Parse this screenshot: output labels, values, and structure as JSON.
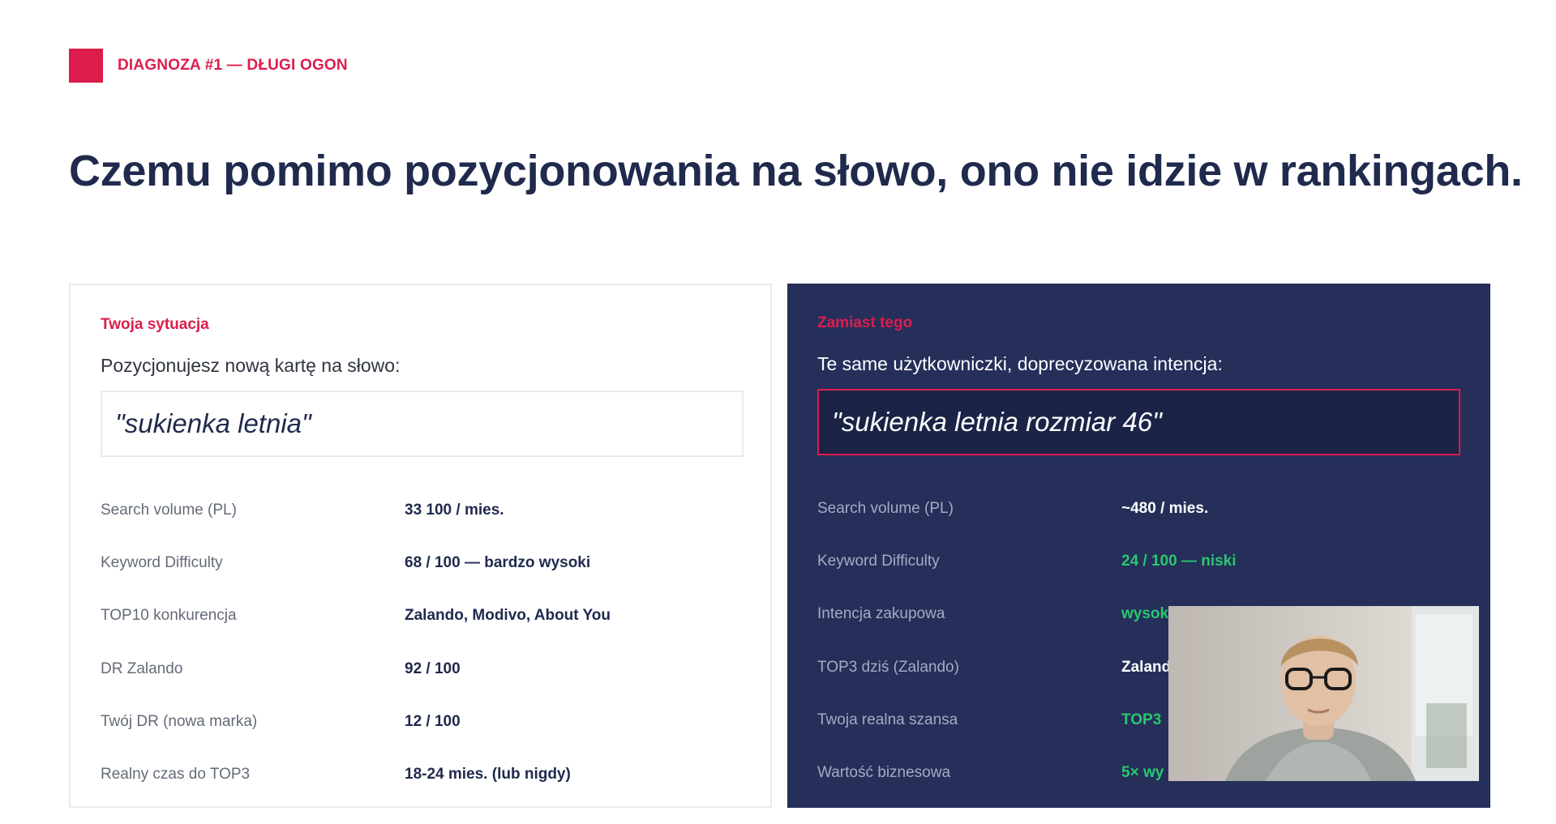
{
  "header": {
    "eyebrow": "DIAGNOZA #1 — DŁUGI OGON",
    "title": "Czemu pomimo pozycjonowania na słowo, ono nie idzie w rankingach."
  },
  "left_panel": {
    "label": "Twoja sytuacja",
    "intro": "Pozycjonujesz nową kartę na słowo:",
    "keyword": "\"sukienka letnia\"",
    "rows": [
      {
        "label": "Search volume (PL)",
        "value": "33 100 / mies."
      },
      {
        "label": "Keyword Difficulty",
        "value": "68 / 100 — bardzo wysoki"
      },
      {
        "label": "TOP10 konkurencja",
        "value": "Zalando, Modivo, About You"
      },
      {
        "label": "DR Zalando",
        "value": "92 / 100"
      },
      {
        "label": "Twój DR (nowa marka)",
        "value": "12 / 100"
      },
      {
        "label": "Realny czas do TOP3",
        "value": "18-24 mies. (lub nigdy)"
      }
    ]
  },
  "right_panel": {
    "label": "Zamiast tego",
    "intro": "Te same użytkowniczki, doprecyzowana intencja:",
    "keyword": "\"sukienka letnia rozmiar 46\"",
    "rows": [
      {
        "label": "Search volume (PL)",
        "value": "~480 / mies.",
        "color": "white"
      },
      {
        "label": "Keyword Difficulty",
        "value": "24 / 100 — niski",
        "color": "green"
      },
      {
        "label": "Intencja zakupowa",
        "value": "wysoka — konkretny rozmiar",
        "color": "green"
      },
      {
        "label": "TOP3 dziś (Zalando)",
        "value": "Zaland",
        "color": "white"
      },
      {
        "label": "Twoja realna szansa",
        "value": "TOP3",
        "color": "green"
      },
      {
        "label": "Wartość biznesowa",
        "value": "5× wy",
        "color": "green"
      }
    ]
  },
  "colors": {
    "accent": "#dc1d4c",
    "navy": "#252f5a",
    "title": "#1f2a4d",
    "positive": "#28c76f"
  }
}
